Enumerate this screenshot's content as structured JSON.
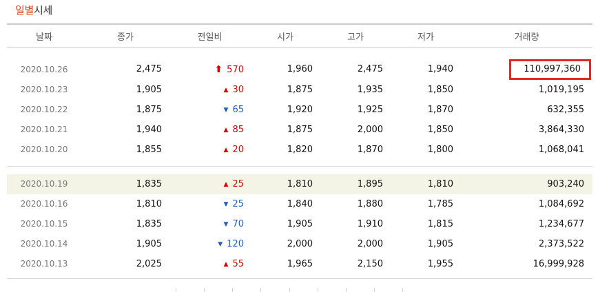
{
  "title": {
    "accent": "일별",
    "rest": "시세"
  },
  "columns": [
    "날짜",
    "종가",
    "전일비",
    "시가",
    "고가",
    "저가",
    "거래량"
  ],
  "colors": {
    "up": "#d60000",
    "down": "#1e5fc4",
    "highlight_row": "#f4f4e6",
    "box": "#e0281e"
  },
  "rows": [
    {
      "date": "2020.10.26",
      "close": "2,475",
      "dir": "limit-up",
      "change": "570",
      "open": "1,960",
      "high": "2,475",
      "low": "1,940",
      "volume": "110,997,360"
    },
    {
      "date": "2020.10.23",
      "close": "1,905",
      "dir": "up",
      "change": "30",
      "open": "1,875",
      "high": "1,935",
      "low": "1,850",
      "volume": "1,019,195"
    },
    {
      "date": "2020.10.22",
      "close": "1,875",
      "dir": "down",
      "change": "65",
      "open": "1,920",
      "high": "1,925",
      "low": "1,870",
      "volume": "632,355"
    },
    {
      "date": "2020.10.21",
      "close": "1,940",
      "dir": "up",
      "change": "85",
      "open": "1,875",
      "high": "2,000",
      "low": "1,850",
      "volume": "3,864,330"
    },
    {
      "date": "2020.10.20",
      "close": "1,855",
      "dir": "up",
      "change": "20",
      "open": "1,820",
      "high": "1,870",
      "low": "1,800",
      "volume": "1,068,041"
    },
    {
      "date": "2020.10.19",
      "close": "1,835",
      "dir": "up",
      "change": "25",
      "open": "1,810",
      "high": "1,895",
      "low": "1,810",
      "volume": "903,240"
    },
    {
      "date": "2020.10.16",
      "close": "1,810",
      "dir": "down",
      "change": "25",
      "open": "1,840",
      "high": "1,880",
      "low": "1,785",
      "volume": "1,084,692"
    },
    {
      "date": "2020.10.15",
      "close": "1,835",
      "dir": "down",
      "change": "70",
      "open": "1,905",
      "high": "1,910",
      "low": "1,815",
      "volume": "1,234,677"
    },
    {
      "date": "2020.10.14",
      "close": "1,905",
      "dir": "down",
      "change": "120",
      "open": "2,000",
      "high": "2,000",
      "low": "1,905",
      "volume": "2,373,522"
    },
    {
      "date": "2020.10.13",
      "close": "2,025",
      "dir": "up",
      "change": "55",
      "open": "1,965",
      "high": "2,150",
      "low": "1,955",
      "volume": "16,999,928"
    }
  ]
}
